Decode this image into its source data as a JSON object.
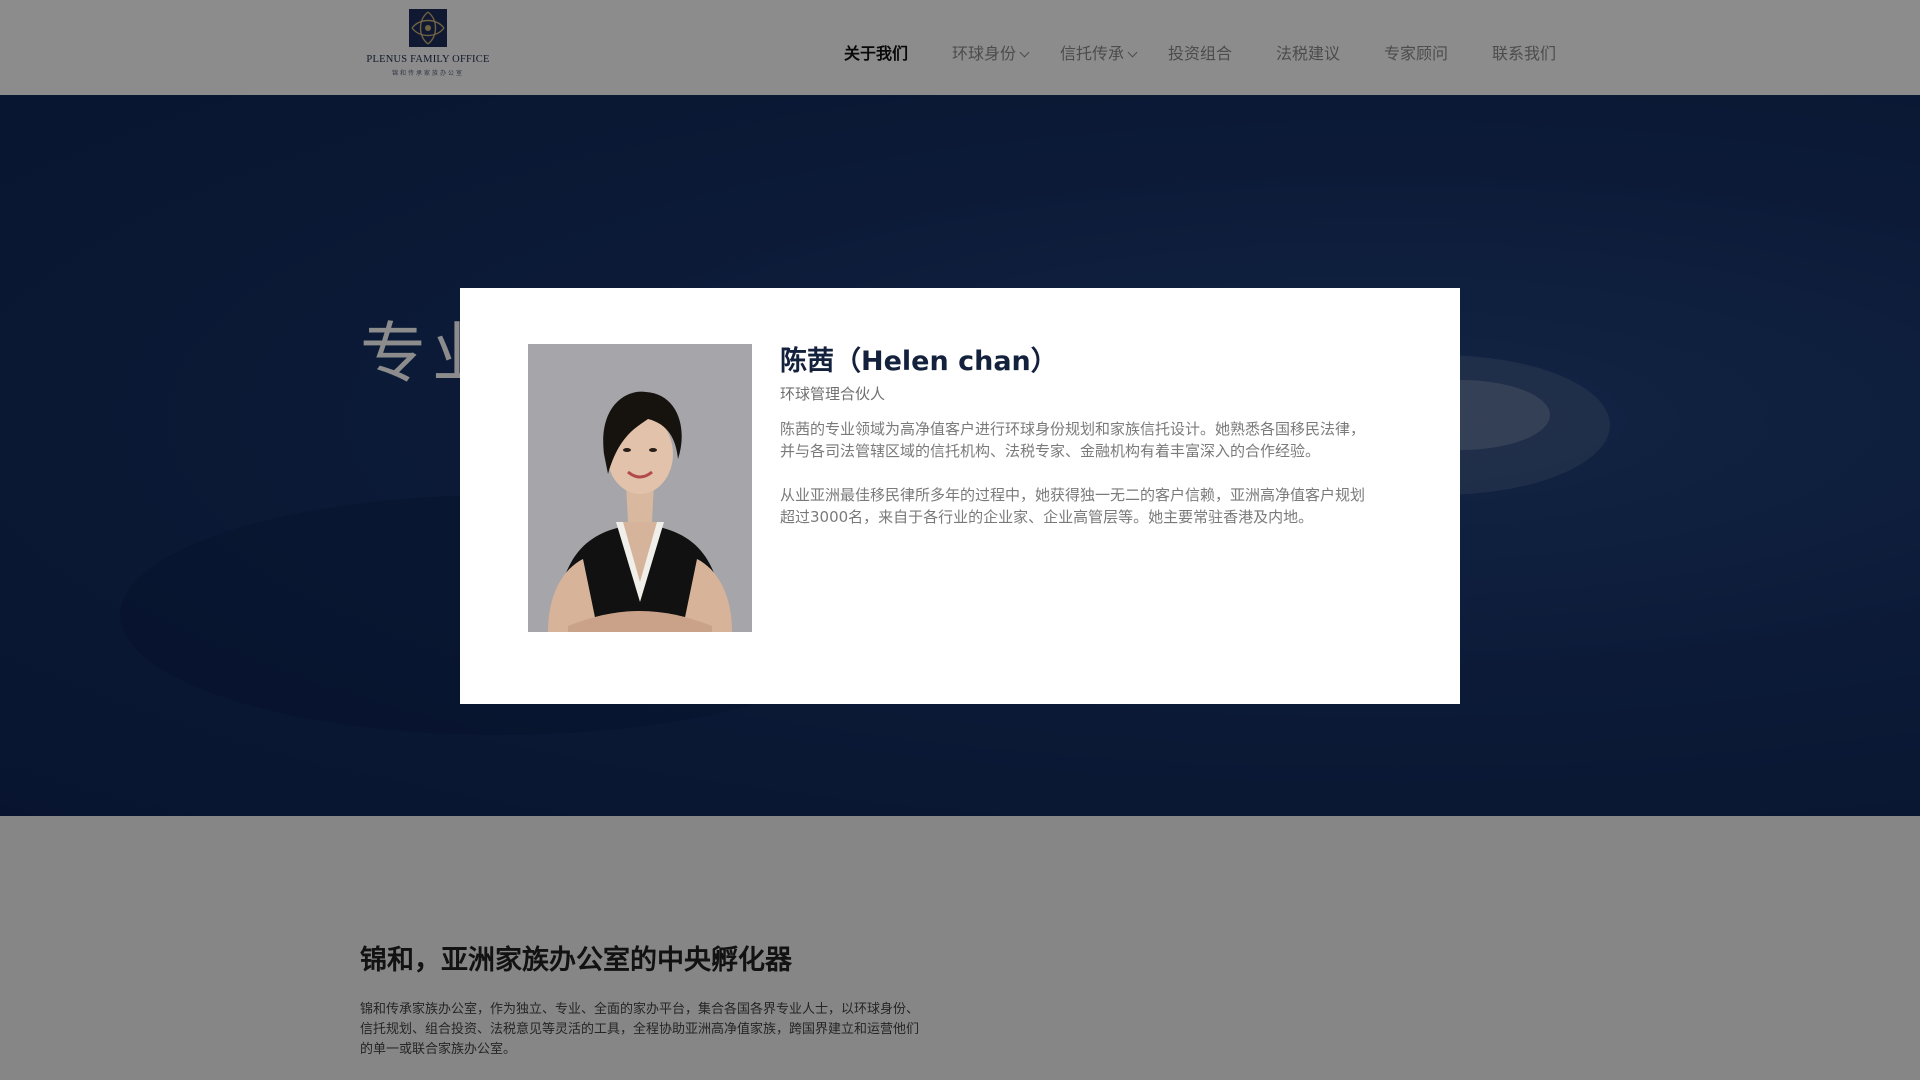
{
  "header": {
    "logo_text": "PLENUS FAMILY OFFICE",
    "logo_subtext": "锦和传承家族办公室",
    "nav": [
      {
        "label": "关于我们",
        "active": true,
        "dropdown": false
      },
      {
        "label": "环球身份",
        "active": false,
        "dropdown": true
      },
      {
        "label": "信托传承",
        "active": false,
        "dropdown": true
      },
      {
        "label": "投资组合",
        "active": false,
        "dropdown": false
      },
      {
        "label": "法税建议",
        "active": false,
        "dropdown": false
      },
      {
        "label": "专家顾问",
        "active": false,
        "dropdown": false
      },
      {
        "label": "联系我们",
        "active": false,
        "dropdown": false
      }
    ]
  },
  "hero": {
    "title": "专业"
  },
  "intro": {
    "heading": "锦和，亚洲家族办公室的中央孵化器",
    "text": "锦和传承家族办公室，作为独立、专业、全面的家办平台，集合各国各界专业人士，以环球身份、信托规划、组合投资、法税意见等灵活的工具，全程协助亚洲高净值家族，跨国界建立和运营他们的单一或联合家族办公室。"
  },
  "modal": {
    "name": "陈茜（Helen chan）",
    "role": "环球管理合伙人",
    "paragraphs": [
      "陈茜的专业领域为高净值客户进行环球身份规划和家族信托设计。她熟悉各国移民法律，并与各司法管辖区域的信托机构、法税专家、金融机构有着丰富深入的合作经验。",
      "从业亚洲最佳移民律所多年的过程中，她获得独一无二的客户信赖，亚洲高净值客户规划超过3000名，来自于各行业的企业家、企业高管层等。她主要常驻香港及内地。"
    ]
  },
  "colors": {
    "brand_navy": "#14213d",
    "hero_blue": "#163166"
  }
}
